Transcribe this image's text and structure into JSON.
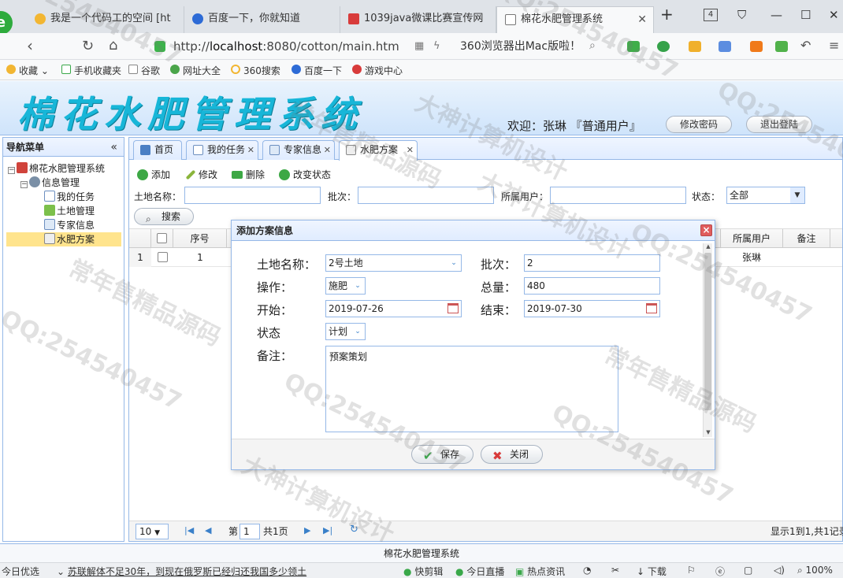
{
  "browser": {
    "tabs": [
      {
        "label": "我是一个代码工的空间 [ht",
        "icon": "star-icon",
        "color": "#f2b632"
      },
      {
        "label": "百度一下，你就知道",
        "icon": "baidu-paw-icon",
        "color": "#2d6bd6"
      },
      {
        "label": "1039java微课比赛宣传网",
        "icon": "site-icon",
        "color": "#d83b3b"
      },
      {
        "label": "棉花水肥管理系统",
        "icon": "page-icon",
        "color": "#777777"
      }
    ],
    "tab_count": "4",
    "url_prefix": "http://",
    "url_host": "localhost",
    "url_rest": ":8080/cotton/main.htm",
    "search_hint": "360浏览器出Mac版啦！",
    "bookmarks": [
      "收藏",
      "手机收藏夹",
      "谷歌",
      "网址大全",
      "360搜索",
      "百度一下",
      "游戏中心"
    ]
  },
  "app": {
    "title": "棉花水肥管理系统",
    "welcome": "欢迎：张琳 『普通用户』",
    "change_password": "修改密码",
    "logout": "退出登陆",
    "footer": "棉花水肥管理系统"
  },
  "nav": {
    "title": "导航菜单",
    "collapse_glyph": "«",
    "root": "棉花水肥管理系统",
    "group": "信息管理",
    "items": [
      "我的任务",
      "土地管理",
      "专家信息",
      "水肥方案"
    ]
  },
  "tabs": [
    "首页",
    "我的任务",
    "专家信息",
    "水肥方案"
  ],
  "toolbar": {
    "add": "添加",
    "edit": "修改",
    "delete": "删除",
    "change_status": "改变状态"
  },
  "filters": {
    "land_label": "土地名称：",
    "batch_label": "批次：",
    "user_label": "所属用户：",
    "status_label": "状态：",
    "status_value": "全部",
    "search": "搜索"
  },
  "grid": {
    "headers": {
      "seq": "序号",
      "user": "所属用户",
      "note": "备注"
    },
    "rows": [
      {
        "rownum": "1",
        "seq": "1",
        "user": "张琳",
        "note": ""
      }
    ]
  },
  "pager": {
    "page_size": "10",
    "page_prefix": "第",
    "page": "1",
    "page_suffix": "共1页",
    "summary": "显示1到1,共1记录"
  },
  "dialog": {
    "title": "添加方案信息",
    "close_glyph": "×",
    "land_label": "土地名称：",
    "land_value": "2号土地",
    "batch_label": "批次：",
    "batch_value": "2",
    "op_label": "操作：",
    "op_value": "施肥",
    "total_label": "总量：",
    "total_value": "480",
    "start_label": "开始：",
    "start_value": "2019-07-26",
    "end_label": "结束：",
    "end_value": "2019-07-30",
    "status_label": "状态",
    "status_value": "计划",
    "note_label": "备注：",
    "note_value": "预案策划",
    "save": "保存",
    "cancel": "关闭"
  },
  "statusbar": {
    "left": "今日优选",
    "news": "苏联解体不足30年，到现在俄罗斯已经归还我国多少领土",
    "quick": "快剪辑",
    "live": "今日直播",
    "hot": "热点资讯",
    "download": "下载",
    "zoom": "100%"
  },
  "watermarks": [
    "QQ:254540457",
    "常年售精品源码",
    "大神计算机设计"
  ]
}
